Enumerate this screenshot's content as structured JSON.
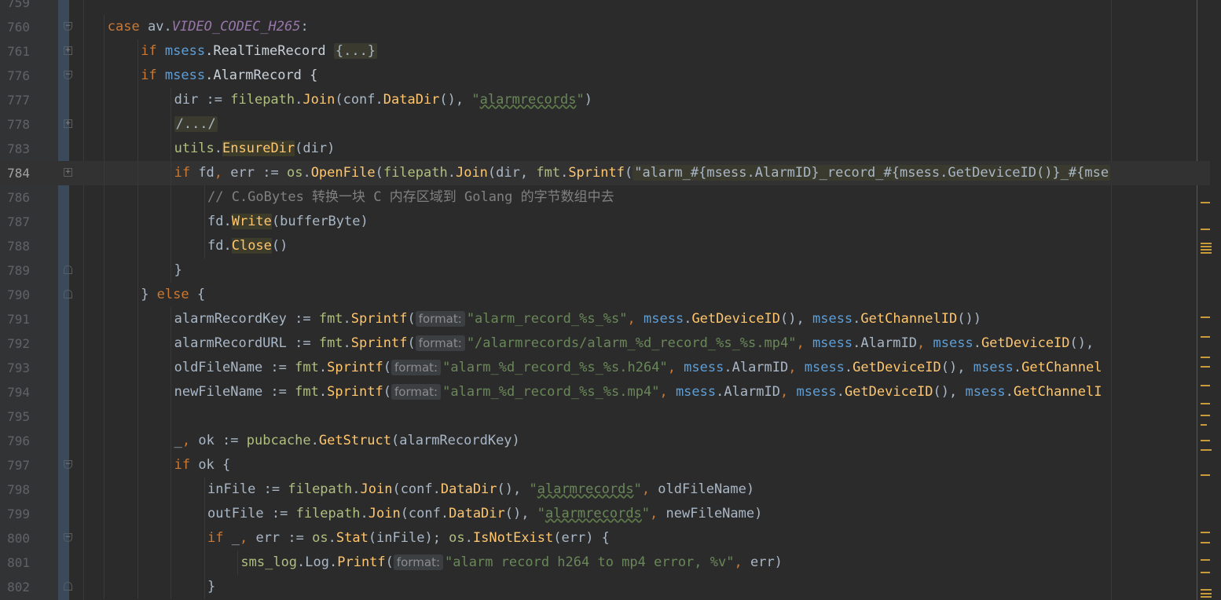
{
  "editor": {
    "lines": [
      {
        "num": "759",
        "indent": 0,
        "fold": "",
        "current": false,
        "tokens": []
      },
      {
        "num": "760",
        "indent": 2,
        "fold": "open",
        "current": false,
        "tokens": [
          {
            "t": "case ",
            "c": "kw"
          },
          {
            "t": "av",
            "c": "var"
          },
          {
            "t": ".",
            "c": "var"
          },
          {
            "t": "VIDEO_CODEC_H265",
            "c": "const"
          },
          {
            "t": ":",
            "c": "var"
          }
        ]
      },
      {
        "num": "761",
        "indent": 3,
        "fold": "plus",
        "current": false,
        "tokens": [
          {
            "t": "if ",
            "c": "kw"
          },
          {
            "t": "msess",
            "c": "mself"
          },
          {
            "t": ".RealTimeRecord ",
            "c": "mth"
          },
          {
            "t": "{...}",
            "c": "fold-ph"
          }
        ]
      },
      {
        "num": "776",
        "indent": 3,
        "fold": "open",
        "current": false,
        "tokens": [
          {
            "t": "if ",
            "c": "kw"
          },
          {
            "t": "msess",
            "c": "mself"
          },
          {
            "t": ".AlarmRecord {",
            "c": "mth"
          }
        ]
      },
      {
        "num": "777",
        "indent": 4,
        "fold": "",
        "current": false,
        "tokens": [
          {
            "t": "dir := ",
            "c": "var"
          },
          {
            "t": "filepath",
            "c": "pkg"
          },
          {
            "t": ".",
            "c": "var"
          },
          {
            "t": "Join",
            "c": "call"
          },
          {
            "t": "(conf.",
            "c": "var"
          },
          {
            "t": "DataDir",
            "c": "call"
          },
          {
            "t": "(), ",
            "c": "var"
          },
          {
            "t": "\"",
            "c": "str"
          },
          {
            "t": "alarmrecords",
            "c": "str wavy"
          },
          {
            "t": "\"",
            "c": "str"
          },
          {
            "t": ")",
            "c": "var"
          }
        ]
      },
      {
        "num": "778",
        "indent": 4,
        "fold": "plus",
        "current": false,
        "tokens": [
          {
            "t": "/.../",
            "c": "fold-ph"
          }
        ]
      },
      {
        "num": "783",
        "indent": 4,
        "fold": "",
        "current": false,
        "tokens": [
          {
            "t": "utils",
            "c": "pkg"
          },
          {
            "t": ".",
            "c": "var"
          },
          {
            "t": "EnsureDir",
            "c": "call hl"
          },
          {
            "t": "(dir)",
            "c": "var"
          }
        ]
      },
      {
        "num": "784",
        "indent": 4,
        "fold": "plus",
        "current": true,
        "tokens": [
          {
            "t": "if ",
            "c": "kw"
          },
          {
            "t": "fd",
            "c": "var"
          },
          {
            "t": ", ",
            "c": "kw"
          },
          {
            "t": "err ",
            "c": "var"
          },
          {
            "t": ":= ",
            "c": "var"
          },
          {
            "t": "os",
            "c": "pkg"
          },
          {
            "t": ".",
            "c": "var"
          },
          {
            "t": "OpenFile",
            "c": "call"
          },
          {
            "t": "(",
            "c": "var"
          },
          {
            "t": "filepath",
            "c": "pkg"
          },
          {
            "t": ".",
            "c": "var"
          },
          {
            "t": "Join",
            "c": "call"
          },
          {
            "t": "(dir, ",
            "c": "var"
          },
          {
            "t": "fmt",
            "c": "pkg"
          },
          {
            "t": ".",
            "c": "var"
          },
          {
            "t": "Sprintf",
            "c": "call"
          },
          {
            "t": "(",
            "c": "var"
          },
          {
            "t": "\"alarm_#{msess.AlarmID}_record_#{msess.GetDeviceID()}_#{mse",
            "c": "fold-ph"
          }
        ]
      },
      {
        "num": "786",
        "indent": 5,
        "fold": "",
        "current": false,
        "tokens": [
          {
            "t": "// C.GoBytes 转换一块 C 内存区域到 Golang 的字节数组中去",
            "c": "cmt"
          }
        ]
      },
      {
        "num": "787",
        "indent": 5,
        "fold": "",
        "current": false,
        "tokens": [
          {
            "t": "fd.",
            "c": "var"
          },
          {
            "t": "Write",
            "c": "call hl"
          },
          {
            "t": "(bufferByte)",
            "c": "var"
          }
        ]
      },
      {
        "num": "788",
        "indent": 5,
        "fold": "",
        "current": false,
        "tokens": [
          {
            "t": "fd.",
            "c": "var"
          },
          {
            "t": "Close",
            "c": "call hl"
          },
          {
            "t": "()",
            "c": "var"
          }
        ]
      },
      {
        "num": "789",
        "indent": 4,
        "fold": "end",
        "current": false,
        "tokens": [
          {
            "t": "}",
            "c": "var"
          }
        ]
      },
      {
        "num": "790",
        "indent": 3,
        "fold": "end",
        "current": false,
        "tokens": [
          {
            "t": "} ",
            "c": "var"
          },
          {
            "t": "else",
            "c": "kw"
          },
          {
            "t": " {",
            "c": "var"
          }
        ]
      },
      {
        "num": "791",
        "indent": 4,
        "fold": "",
        "current": false,
        "tokens": [
          {
            "t": "alarmRecordKey := ",
            "c": "var"
          },
          {
            "t": "fmt",
            "c": "pkg"
          },
          {
            "t": ".",
            "c": "var"
          },
          {
            "t": "Sprintf",
            "c": "call"
          },
          {
            "t": "(",
            "c": "var"
          },
          {
            "t": "format:",
            "c": "hint"
          },
          {
            "t": "\"alarm_record_%s_%s\"",
            "c": "str"
          },
          {
            "t": ", ",
            "c": "kw"
          },
          {
            "t": "msess",
            "c": "mself"
          },
          {
            "t": ".",
            "c": "var"
          },
          {
            "t": "GetDeviceID",
            "c": "call"
          },
          {
            "t": "(), ",
            "c": "var"
          },
          {
            "t": "msess",
            "c": "mself"
          },
          {
            "t": ".",
            "c": "var"
          },
          {
            "t": "GetChannelID",
            "c": "call"
          },
          {
            "t": "())",
            "c": "var"
          }
        ]
      },
      {
        "num": "792",
        "indent": 4,
        "fold": "",
        "current": false,
        "tokens": [
          {
            "t": "alarmRecordURL := ",
            "c": "var"
          },
          {
            "t": "fmt",
            "c": "pkg"
          },
          {
            "t": ".",
            "c": "var"
          },
          {
            "t": "Sprintf",
            "c": "call"
          },
          {
            "t": "(",
            "c": "var"
          },
          {
            "t": "format:",
            "c": "hint"
          },
          {
            "t": "\"/alarmrecords/alarm_%d_record_%s_%s.mp4\"",
            "c": "str"
          },
          {
            "t": ", ",
            "c": "kw"
          },
          {
            "t": "msess",
            "c": "mself"
          },
          {
            "t": ".AlarmID",
            "c": "var"
          },
          {
            "t": ", ",
            "c": "kw"
          },
          {
            "t": "msess",
            "c": "mself"
          },
          {
            "t": ".",
            "c": "var"
          },
          {
            "t": "GetDeviceID",
            "c": "call"
          },
          {
            "t": "(),",
            "c": "var"
          }
        ]
      },
      {
        "num": "793",
        "indent": 4,
        "fold": "",
        "current": false,
        "tokens": [
          {
            "t": "oldFileName := ",
            "c": "var"
          },
          {
            "t": "fmt",
            "c": "pkg"
          },
          {
            "t": ".",
            "c": "var"
          },
          {
            "t": "Sprintf",
            "c": "call"
          },
          {
            "t": "(",
            "c": "var"
          },
          {
            "t": "format:",
            "c": "hint"
          },
          {
            "t": "\"alarm_%d_record_%s_%s.h264\"",
            "c": "str"
          },
          {
            "t": ", ",
            "c": "kw"
          },
          {
            "t": "msess",
            "c": "mself"
          },
          {
            "t": ".AlarmID",
            "c": "var"
          },
          {
            "t": ", ",
            "c": "kw"
          },
          {
            "t": "msess",
            "c": "mself"
          },
          {
            "t": ".",
            "c": "var"
          },
          {
            "t": "GetDeviceID",
            "c": "call"
          },
          {
            "t": "(), ",
            "c": "var"
          },
          {
            "t": "msess",
            "c": "mself"
          },
          {
            "t": ".",
            "c": "var"
          },
          {
            "t": "GetChannel",
            "c": "call"
          }
        ]
      },
      {
        "num": "794",
        "indent": 4,
        "fold": "",
        "current": false,
        "tokens": [
          {
            "t": "newFileName := ",
            "c": "var"
          },
          {
            "t": "fmt",
            "c": "pkg"
          },
          {
            "t": ".",
            "c": "var"
          },
          {
            "t": "Sprintf",
            "c": "call"
          },
          {
            "t": "(",
            "c": "var"
          },
          {
            "t": "format:",
            "c": "hint"
          },
          {
            "t": "\"alarm_%d_record_%s_%s.mp4\"",
            "c": "str"
          },
          {
            "t": ", ",
            "c": "kw"
          },
          {
            "t": "msess",
            "c": "mself"
          },
          {
            "t": ".AlarmID",
            "c": "var"
          },
          {
            "t": ", ",
            "c": "kw"
          },
          {
            "t": "msess",
            "c": "mself"
          },
          {
            "t": ".",
            "c": "var"
          },
          {
            "t": "GetDeviceID",
            "c": "call"
          },
          {
            "t": "(), ",
            "c": "var"
          },
          {
            "t": "msess",
            "c": "mself"
          },
          {
            "t": ".",
            "c": "var"
          },
          {
            "t": "GetChannelI",
            "c": "call"
          }
        ]
      },
      {
        "num": "795",
        "indent": 4,
        "fold": "",
        "current": false,
        "tokens": []
      },
      {
        "num": "796",
        "indent": 4,
        "fold": "",
        "current": false,
        "tokens": [
          {
            "t": "_",
            "c": "var"
          },
          {
            "t": ", ",
            "c": "kw"
          },
          {
            "t": "ok := ",
            "c": "var"
          },
          {
            "t": "pubcache",
            "c": "pkg"
          },
          {
            "t": ".",
            "c": "var"
          },
          {
            "t": "GetStruct",
            "c": "call"
          },
          {
            "t": "(alarmRecordKey)",
            "c": "var"
          }
        ]
      },
      {
        "num": "797",
        "indent": 4,
        "fold": "open",
        "current": false,
        "tokens": [
          {
            "t": "if ",
            "c": "kw"
          },
          {
            "t": "ok {",
            "c": "var"
          }
        ]
      },
      {
        "num": "798",
        "indent": 5,
        "fold": "",
        "current": false,
        "tokens": [
          {
            "t": "inFile := ",
            "c": "var"
          },
          {
            "t": "filepath",
            "c": "pkg"
          },
          {
            "t": ".",
            "c": "var"
          },
          {
            "t": "Join",
            "c": "call"
          },
          {
            "t": "(conf.",
            "c": "var"
          },
          {
            "t": "DataDir",
            "c": "call"
          },
          {
            "t": "(), ",
            "c": "var"
          },
          {
            "t": "\"",
            "c": "str"
          },
          {
            "t": "alarmrecords",
            "c": "str wavy"
          },
          {
            "t": "\"",
            "c": "str"
          },
          {
            "t": ", ",
            "c": "kw"
          },
          {
            "t": "oldFileName)",
            "c": "var"
          }
        ]
      },
      {
        "num": "799",
        "indent": 5,
        "fold": "",
        "current": false,
        "tokens": [
          {
            "t": "outFile := ",
            "c": "var"
          },
          {
            "t": "filepath",
            "c": "pkg"
          },
          {
            "t": ".",
            "c": "var"
          },
          {
            "t": "Join",
            "c": "call"
          },
          {
            "t": "(conf.",
            "c": "var"
          },
          {
            "t": "DataDir",
            "c": "call"
          },
          {
            "t": "(), ",
            "c": "var"
          },
          {
            "t": "\"",
            "c": "str"
          },
          {
            "t": "alarmrecords",
            "c": "str wavy"
          },
          {
            "t": "\"",
            "c": "str"
          },
          {
            "t": ", ",
            "c": "kw"
          },
          {
            "t": "newFileName)",
            "c": "var"
          }
        ]
      },
      {
        "num": "800",
        "indent": 5,
        "fold": "open",
        "current": false,
        "tokens": [
          {
            "t": "if ",
            "c": "kw"
          },
          {
            "t": "_",
            "c": "var"
          },
          {
            "t": ", ",
            "c": "kw"
          },
          {
            "t": "err ",
            "c": "var"
          },
          {
            "t": ":= ",
            "c": "var"
          },
          {
            "t": "os",
            "c": "pkg"
          },
          {
            "t": ".",
            "c": "var"
          },
          {
            "t": "Stat",
            "c": "call"
          },
          {
            "t": "(inFile); ",
            "c": "var"
          },
          {
            "t": "os",
            "c": "pkg"
          },
          {
            "t": ".",
            "c": "var"
          },
          {
            "t": "IsNotExist",
            "c": "call"
          },
          {
            "t": "(err) {",
            "c": "var"
          }
        ]
      },
      {
        "num": "801",
        "indent": 6,
        "fold": "",
        "current": false,
        "tokens": [
          {
            "t": "sms_log",
            "c": "pkg"
          },
          {
            "t": ".Log.",
            "c": "var"
          },
          {
            "t": "Printf",
            "c": "call"
          },
          {
            "t": "(",
            "c": "var"
          },
          {
            "t": "format:",
            "c": "hint"
          },
          {
            "t": "\"alarm record h264 to mp4 error, %v\"",
            "c": "str"
          },
          {
            "t": ", ",
            "c": "kw"
          },
          {
            "t": "err)",
            "c": "var"
          }
        ]
      },
      {
        "num": "802",
        "indent": 5,
        "fold": "end",
        "current": false,
        "tokens": [
          {
            "t": "}",
            "c": "var"
          }
        ]
      }
    ]
  },
  "colors": {
    "background": "#2b2b2b",
    "gutter": "#313335",
    "keyword": "#cc7832",
    "string": "#6a8759",
    "function": "#ffc66d",
    "field": "#9876aa",
    "receiver": "#5e9ed6",
    "comment": "#808080",
    "warning_stripe": "#c89b3a"
  }
}
